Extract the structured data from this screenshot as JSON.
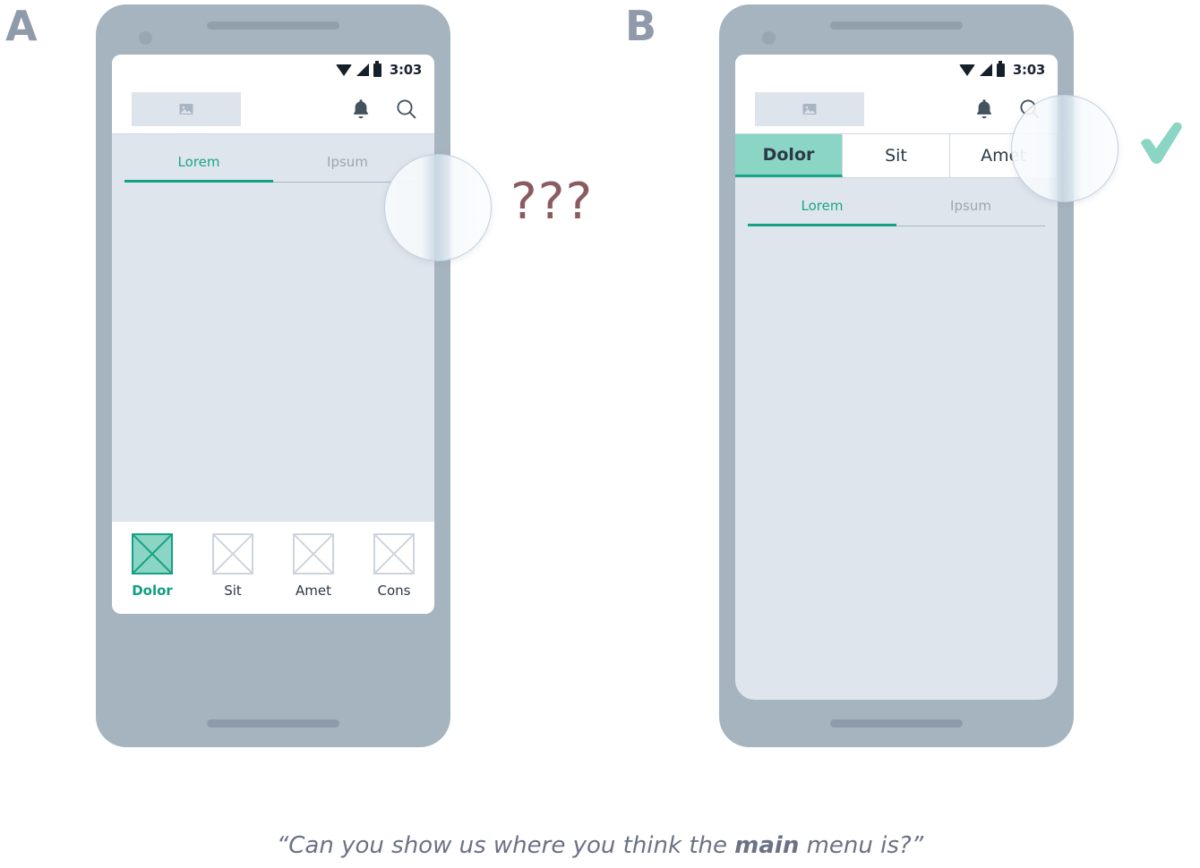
{
  "panels": [
    {
      "label": "A"
    },
    {
      "label": "B"
    }
  ],
  "statusbar": {
    "time": "3:03",
    "icons": [
      "wifi-icon",
      "signal-icon",
      "battery-icon"
    ]
  },
  "appbar": {
    "logo_icon": "image-placeholder-icon",
    "actions": [
      {
        "icon": "bell-icon"
      },
      {
        "icon": "search-icon"
      }
    ]
  },
  "phone_a": {
    "content_tabs": [
      {
        "label": "Lorem",
        "active": true
      },
      {
        "label": "Ipsum",
        "active": false
      }
    ],
    "bottom_nav": [
      {
        "label": "Dolor",
        "active": true
      },
      {
        "label": "Sit",
        "active": false
      },
      {
        "label": "Amet",
        "active": false
      },
      {
        "label": "Cons",
        "active": false
      }
    ]
  },
  "phone_b": {
    "top_tabs": [
      {
        "label": "Dolor",
        "active": true
      },
      {
        "label": "Sit",
        "active": false
      },
      {
        "label": "Amet",
        "active": false
      }
    ],
    "content_tabs": [
      {
        "label": "Lorem",
        "active": true
      },
      {
        "label": "Ipsum",
        "active": false
      }
    ]
  },
  "annotations": {
    "question_marks": "???",
    "check_mark": "check-icon"
  },
  "caption": {
    "before": "“Can you show us where you think the ",
    "emphasis": "main",
    "after": " menu is?”"
  },
  "colors": {
    "teal_accent": "#16a085",
    "mint_fill": "#8ad5c3",
    "phone_body": "#a6b4c0",
    "screen_bg": "#dfe5ec",
    "question_mauve": "#8b5b62",
    "check_mint": "#8ad5c3",
    "label_grey": "#8f9bab",
    "caption_grey": "#6b7285"
  }
}
